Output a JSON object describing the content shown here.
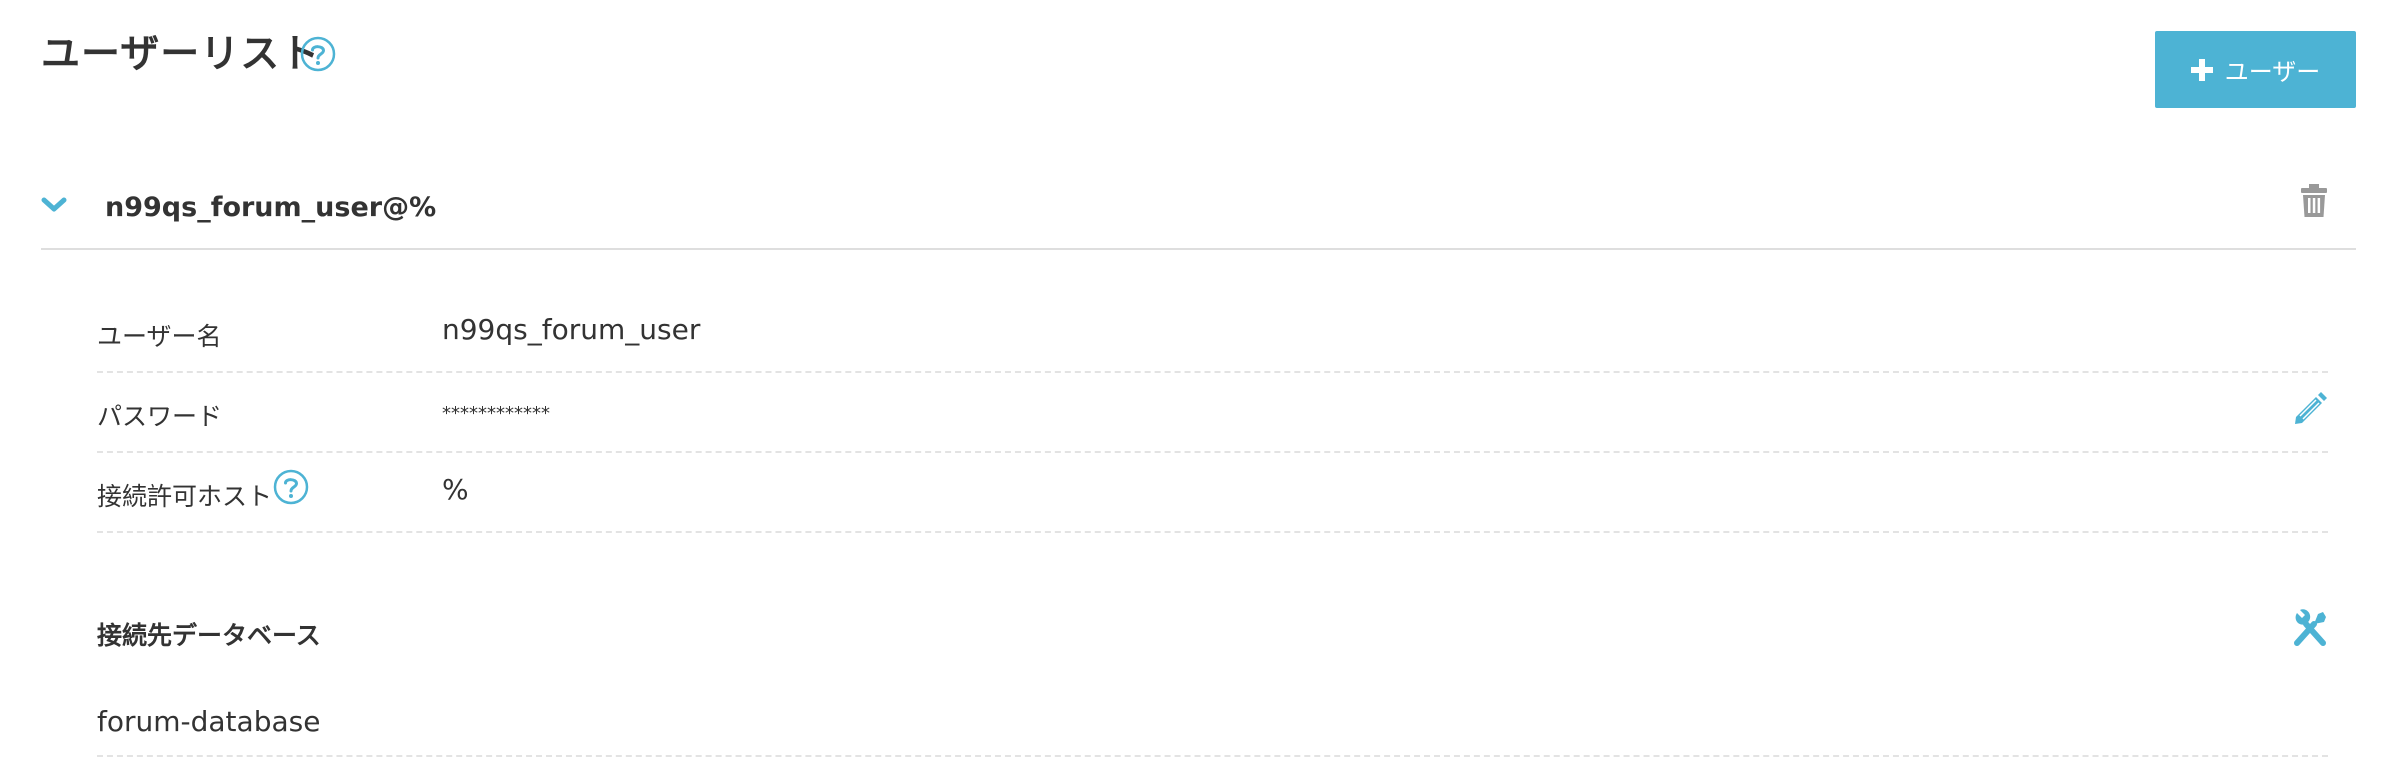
{
  "header": {
    "title": "ユーザーリスト",
    "add_button_label": "ユーザー"
  },
  "user": {
    "title": "n99qs_forum_user@%",
    "expanded": true,
    "fields": {
      "username_label": "ユーザー名",
      "username_value": "n99qs_forum_user",
      "password_label": "パスワード",
      "password_value": "************",
      "host_label": "接続許可ホスト",
      "host_value": "%"
    },
    "databases": {
      "section_title": "接続先データベース",
      "items": [
        "forum-database"
      ]
    }
  },
  "icons": {
    "help": "help-circle-icon",
    "add": "plus-icon",
    "collapse": "chevron-down-icon",
    "delete": "trash-icon",
    "edit": "pencil-icon",
    "settings": "tools-icon"
  },
  "colors": {
    "accent": "#4db3d4",
    "text": "#333333",
    "icon_gray": "#999999",
    "divider": "#dedede"
  }
}
